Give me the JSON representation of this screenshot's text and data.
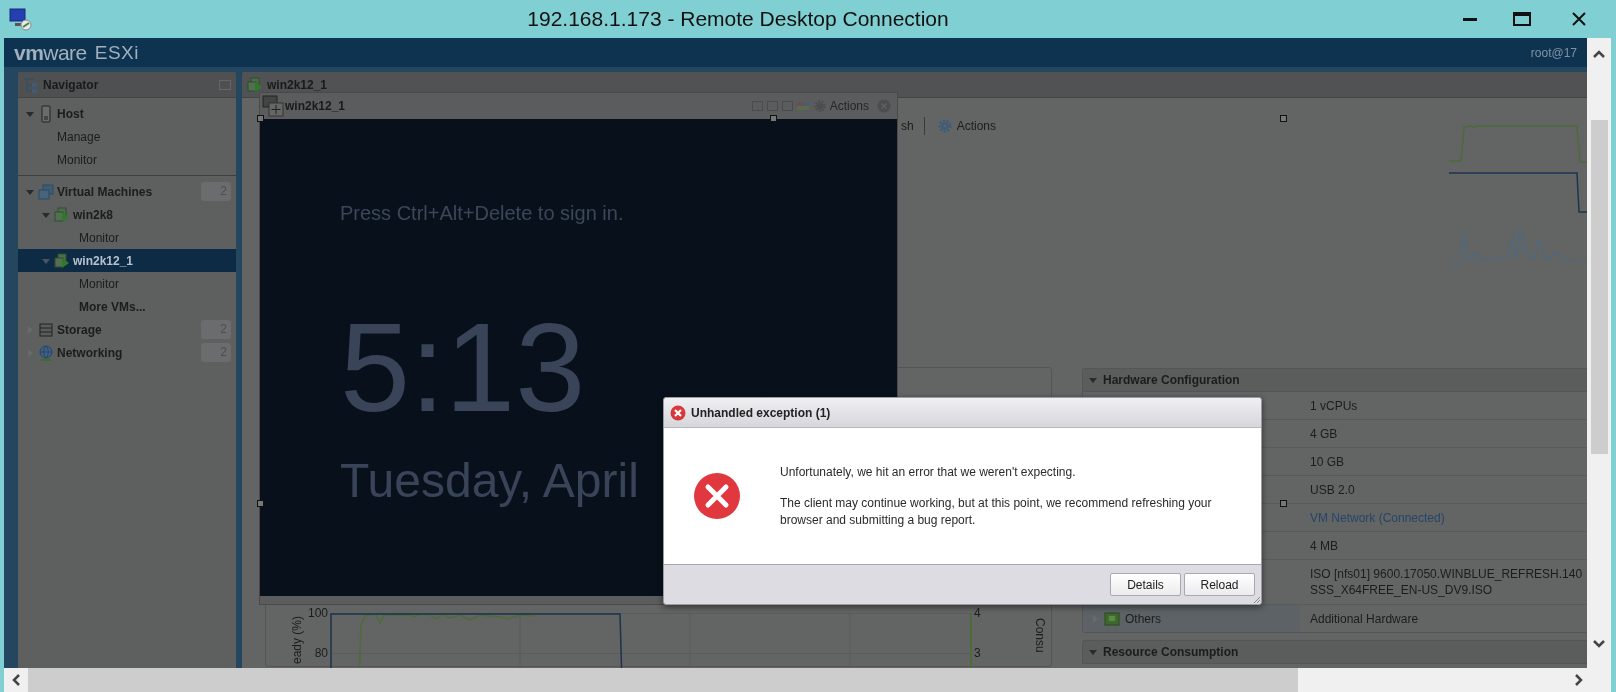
{
  "window": {
    "title": "192.168.1.173 - Remote Desktop Connection"
  },
  "header": {
    "brand": "**vm**ware",
    "product": "ESXi",
    "user": "root@17"
  },
  "navigator": {
    "title": "Navigator",
    "sections": [
      {
        "items": [
          {
            "label": "Host",
            "kind": "host",
            "expanded": true,
            "selected": false,
            "children": [
              {
                "label": "Manage",
                "kind": "page",
                "selected": false
              },
              {
                "label": "Monitor",
                "kind": "page",
                "selected": false
              }
            ]
          }
        ]
      },
      {
        "items": [
          {
            "label": "Virtual Machines",
            "kind": "vms",
            "badge": "2",
            "expanded": true,
            "selected": false,
            "children": [
              {
                "label": "win2k8",
                "kind": "vm",
                "expanded": true,
                "selected": false,
                "children": [
                  {
                    "label": "Monitor",
                    "kind": "page",
                    "selected": false
                  }
                ]
              },
              {
                "label": "win2k12_1",
                "kind": "vm",
                "expanded": true,
                "selected": true,
                "children": [
                  {
                    "label": "Monitor",
                    "kind": "page",
                    "selected": false
                  }
                ]
              },
              {
                "label": "More VMs...",
                "kind": "more",
                "selected": false
              }
            ]
          },
          {
            "label": "Storage",
            "kind": "storage",
            "badge": "2",
            "expanded": false,
            "selected": false
          },
          {
            "label": "Networking",
            "kind": "network",
            "badge": "2",
            "expanded": false,
            "selected": false
          }
        ]
      }
    ]
  },
  "main": {
    "title": "win2k12_1",
    "toolbar": [
      {
        "label": "sh",
        "kind": "text"
      },
      {
        "label": "Actions",
        "kind": "gear"
      }
    ]
  },
  "console": {
    "title": "win2k12_1",
    "actions": "Actions",
    "prompt": "Press Ctrl+Alt+Delete to sign in.",
    "time": "5:13",
    "date": "Tuesday, April"
  },
  "chart_panel": {
    "y_label": "eady (%)",
    "y_ticks": [
      "100",
      "80"
    ],
    "y2_ticks": [
      "4",
      "3"
    ],
    "y2_label": "Consu"
  },
  "hardware": {
    "title": "Hardware Configuration",
    "expanded": true,
    "rows": [
      {
        "kind": "text",
        "lines": [
          "1 vCPUs"
        ]
      },
      {
        "kind": "text",
        "lines": [
          "4 GB"
        ]
      },
      {
        "kind": "text",
        "lines": [
          "10 GB"
        ]
      },
      {
        "kind": "text",
        "lines": [
          "USB 2.0"
        ]
      },
      {
        "kind": "link",
        "lines": [
          "VM Network (Connected)"
        ]
      },
      {
        "kind": "text",
        "lines": [
          "4 MB"
        ]
      },
      {
        "kind": "text",
        "lines": [
          "ISO [nfs01] 9600.17050.WINBLUE_REFRESH.140",
          "SSS_X64FREE_EN-US_DV9.ISO"
        ]
      },
      {
        "kind": "text",
        "label": "Others",
        "expanded": false,
        "lines": [
          "Additional Hardware"
        ]
      }
    ]
  },
  "resource": {
    "title": "Resource Consumption",
    "expanded": true
  },
  "dialog": {
    "title": "Unhandled exception (1)",
    "paragraphs": [
      "Unfortunately, we hit an error that we weren't expecting.",
      "The client may continue working, but at this point, we recommend refreshing your browser and submitting a bug report."
    ],
    "buttons": [
      "Details",
      "Reload"
    ]
  }
}
